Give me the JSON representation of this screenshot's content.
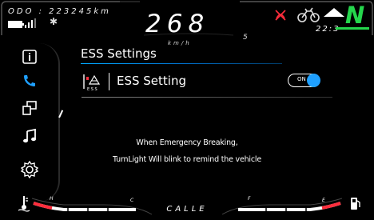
{
  "status": {
    "odometer": "ODO : 223245km",
    "speed": "268",
    "speed_unit": "km/h",
    "gear_digit": "5",
    "clock": "22:3",
    "gear": "N",
    "icons": {
      "battery": "battery-icon",
      "signal": "signal-icon",
      "bluetooth": "bluetooth-icon",
      "warning": "traction-warning-icon",
      "motorcycle": "motorcycle-icon",
      "navigation": "navigation-arrow-icon"
    },
    "colors": {
      "gear": "#25d64c",
      "warning": "#ff2d3c",
      "accent": "#1fa0ff"
    }
  },
  "sidebar": {
    "items": [
      {
        "name": "info",
        "icon": "info-icon"
      },
      {
        "name": "phone",
        "icon": "phone-icon",
        "active": true
      },
      {
        "name": "windows",
        "icon": "windows-icon"
      },
      {
        "name": "music",
        "icon": "music-icon"
      },
      {
        "name": "settings",
        "icon": "gear-icon"
      }
    ]
  },
  "main": {
    "title": "ESS Settings",
    "row": {
      "label": "ESS Setting",
      "icon": "ess-icon",
      "toggle_text": "ON",
      "toggle_on": true
    },
    "message_line1": "When Emergency Breaking,",
    "message_line2": "TurnLight Will blink to remind the vehicle"
  },
  "bottom": {
    "mode": "CALLE",
    "temp_labels": {
      "high": "H",
      "cold": "C"
    },
    "fuel_labels": {
      "full": "F",
      "empty": "E"
    },
    "icons": {
      "temperature": "temperature-icon",
      "fuel": "fuel-pump-icon"
    }
  }
}
